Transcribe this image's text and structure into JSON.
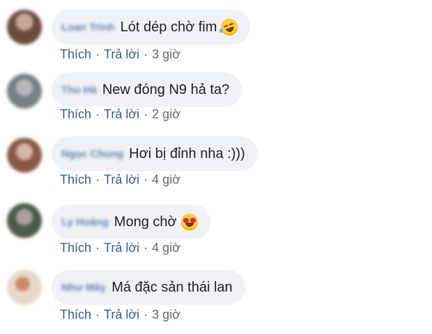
{
  "comments": [
    {
      "name": "Loan Trinh",
      "text": "Lót dép chờ fim",
      "emoji": "laugh",
      "like": "Thích",
      "reply": "Trả lời",
      "time": "3 giờ"
    },
    {
      "name": "Thu Hà",
      "text": "New đóng N9 hả ta?",
      "emoji": "",
      "like": "Thích",
      "reply": "Trả lời",
      "time": "2 giờ"
    },
    {
      "name": "Ngọc Chung",
      "text": "Hơi bị đỉnh nha :)))",
      "emoji": "",
      "like": "Thích",
      "reply": "Trả lời",
      "time": "4 giờ"
    },
    {
      "name": "Ly Hoàng",
      "text": "Mong chờ",
      "emoji": "heart-eyes",
      "like": "Thích",
      "reply": "Trả lời",
      "time": "4 giờ"
    },
    {
      "name": "Như Mây",
      "text": "Má đặc sản thái lan",
      "emoji": "",
      "like": "Thích",
      "reply": "Trả lời",
      "time": "3 giờ"
    }
  ],
  "separator": "·",
  "colors": {
    "bubble": "#f0f2f5",
    "link": "#385898",
    "meta": "#65676b",
    "text": "#1c1e21"
  }
}
